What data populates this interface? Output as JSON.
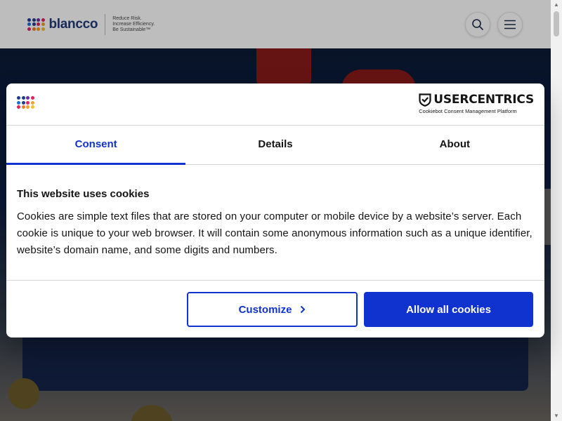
{
  "site": {
    "brand_name": "blancco",
    "tagline_lines": [
      "Reduce Risk.",
      "Increase Efficiency.",
      "Be Sustainable™"
    ],
    "logo_dot_colors": [
      "#1f3a93",
      "#1f3a93",
      "#6f2da8",
      "#e0245e",
      "#1f6fd1",
      "#1f3a93",
      "#e0245e",
      "#f0a030",
      "#e0245e",
      "#f47b20",
      "#f0a030",
      "#f0c030"
    ]
  },
  "header_icons": {
    "search": "search-icon",
    "menu": "menu-icon"
  },
  "cookie_dialog": {
    "vendor_name": "USERCENTRICS",
    "vendor_subtitle": "Cookiebot Consent Management Platform",
    "tabs": [
      {
        "label": "Consent",
        "active": true
      },
      {
        "label": "Details",
        "active": false
      },
      {
        "label": "About",
        "active": false
      }
    ],
    "title": "This website uses cookies",
    "body": "Cookies are simple text files that are stored on your computer or mobile device by a website’s server. Each cookie is unique to your web browser. It will contain some anonymous information such as a unique identifier, website’s domain name, and some digits and numbers.",
    "customize_label": "Customize",
    "allow_all_label": "Allow all cookies"
  },
  "colors": {
    "accent_blue": "#1032cf",
    "dialog_text": "#141414",
    "divider": "#d6d6d6"
  }
}
